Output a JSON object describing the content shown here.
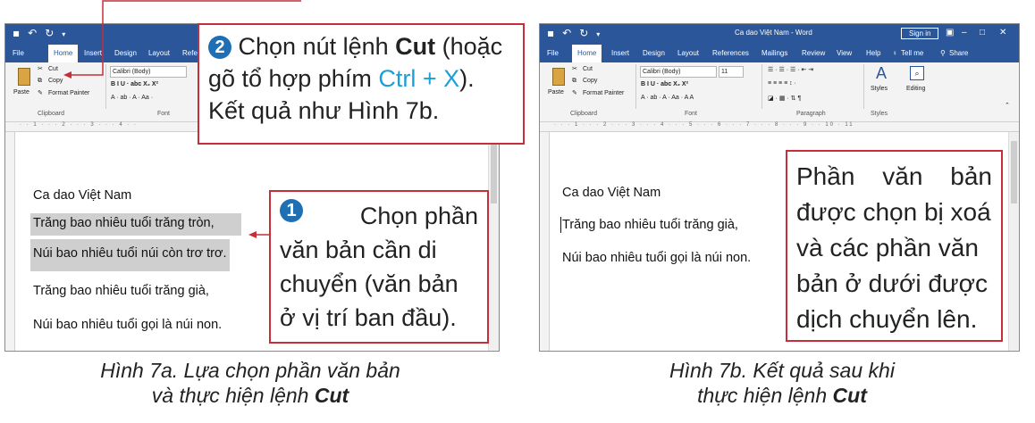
{
  "figure_a": {
    "window": {
      "qat_icons": [
        "save-icon",
        "undo-icon",
        "redo-icon",
        "customize-icon"
      ],
      "tabs": [
        "File",
        "Home",
        "Insert",
        "Design",
        "Layout",
        "Refe"
      ],
      "active_tab": "Home",
      "clipboard": {
        "paste": "Paste",
        "cut": "Cut",
        "copy": "Copy",
        "format_painter": "Format Painter",
        "group_label": "Clipboard"
      },
      "font": {
        "name": "Calibri (Body)",
        "formatting": "B  I  U  ·  abc  X₂  X²",
        "effects": "A ·  ab ·  A ·  Aa ·",
        "group_label": "Font"
      }
    },
    "document": {
      "heading": "Ca dao Việt Nam",
      "lines": [
        "Trăng bao nhiêu tuổi trăng tròn,",
        "Núi bao nhiêu tuổi núi còn trơ trơ.",
        "Trăng bao nhiêu tuổi trăng già,",
        "Núi bao nhiêu tuổi gọi là núi non."
      ]
    },
    "callout_cut": {
      "number": "2",
      "line1_prefix": "Chọn nút lệnh ",
      "line1_bold": "Cut",
      "line1_suffix": " (hoặc",
      "line2_prefix": "gõ tổ hợp phím ",
      "line2_key": "Ctrl + X",
      "line2_suffix": ").",
      "line3": "Kết quả như Hình 7b."
    },
    "callout_select": {
      "number": "1",
      "lines": [
        "Chọn phần",
        "văn bản cần di",
        "chuyển (văn bản",
        "ở vị trí ban đầu)."
      ]
    },
    "caption": {
      "line1": "Hình 7a. Lựa chọn phần văn bản",
      "line2_prefix": "và thực hiện lệnh ",
      "line2_bold": "Cut"
    }
  },
  "figure_b": {
    "window": {
      "title": "Ca dao Việt Nam  -  Word",
      "signin": "Sign in",
      "tabs": [
        "File",
        "Home",
        "Insert",
        "Design",
        "Layout",
        "References",
        "Mailings",
        "Review",
        "View",
        "Help",
        "Tell me",
        "Share"
      ],
      "active_tab": "Home",
      "clipboard": {
        "paste": "Paste",
        "cut": "Cut",
        "copy": "Copy",
        "format_painter": "Format Painter",
        "group_label": "Clipboard"
      },
      "font": {
        "name": "Calibri (Body)",
        "size": "11",
        "formatting": "B  I  U  ·  abc  X₂  X²",
        "effects": "A ·  ab ·  A ·  Aa ·  A  A",
        "group_label": "Font"
      },
      "paragraph_label": "Paragraph",
      "styles_label": "Styles",
      "styles_group": "Styles",
      "editing_label": "Editing"
    },
    "document": {
      "heading": "Ca dao Việt Nam",
      "lines": [
        "Trăng bao nhiêu tuổi trăng già,",
        "Núi bao nhiêu tuổi gọi là núi non."
      ]
    },
    "callout_result": {
      "lines": [
        "Phần văn bản",
        "được chọn bị xoá",
        "và các phần văn",
        "bản ở dưới được",
        "dịch chuyển lên."
      ]
    },
    "caption": {
      "line1": "Hình 7b. Kết quả sau khi",
      "line2_prefix": "thực hiện lệnh ",
      "line2_bold": "Cut"
    }
  },
  "colors": {
    "word_blue": "#2b579a",
    "callout_border": "#c62f3a",
    "number_badge": "#1f6fb5",
    "ctrl_key": "#1aa0d8"
  }
}
